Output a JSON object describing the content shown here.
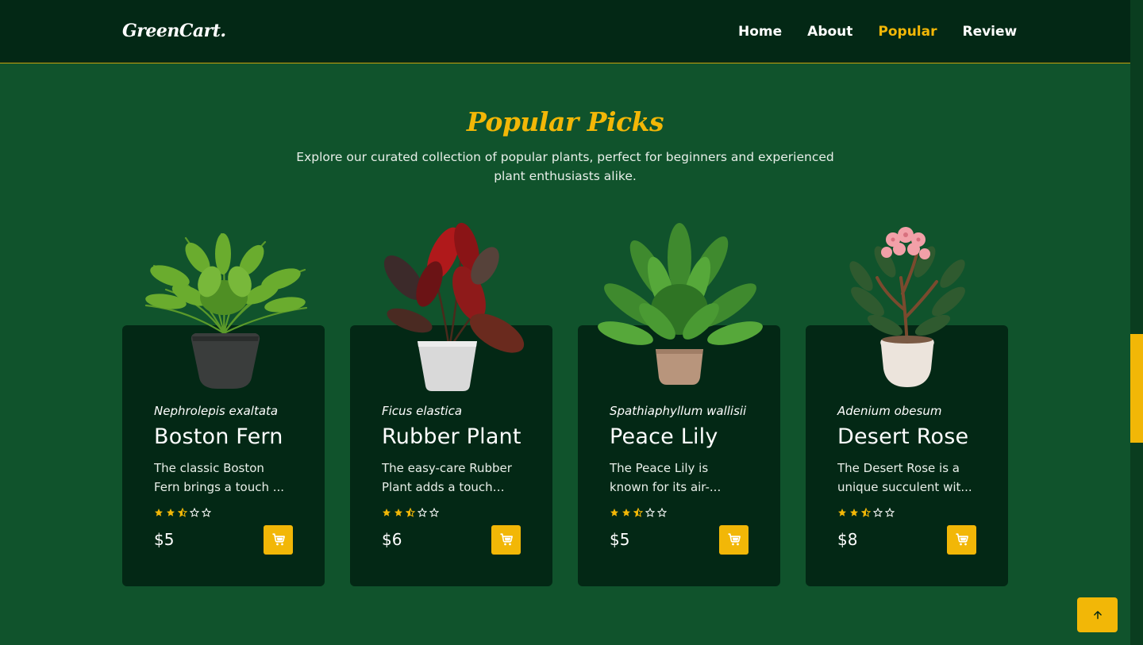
{
  "brand": {
    "logo": "GreenCart."
  },
  "nav": {
    "items": [
      {
        "label": "Home",
        "active": false
      },
      {
        "label": "About",
        "active": false
      },
      {
        "label": "Popular",
        "active": true
      },
      {
        "label": "Review",
        "active": false
      }
    ]
  },
  "section": {
    "title": "Popular Picks",
    "subtitle": "Explore our curated collection of popular plants, perfect for beginners and experienced plant enthusiasts alike."
  },
  "products": [
    {
      "scientific": "Nephrolepis exaltata",
      "name": "Boston Fern",
      "description": "The classic Boston Fern brings a touch ...",
      "rating": 2.5,
      "price": "$5",
      "image": "fern-plant"
    },
    {
      "scientific": "Ficus elastica",
      "name": "Rubber Plant",
      "description": "The easy-care Rubber Plant adds a touch of...",
      "rating": 2.5,
      "price": "$6",
      "image": "rubber-plant"
    },
    {
      "scientific": "Spathiaphyllum wallisii",
      "name": "Peace Lily",
      "description": "The Peace Lily is known for its air-...",
      "rating": 2.5,
      "price": "$5",
      "image": "peace-lily-plant"
    },
    {
      "scientific": "Adenium obesum",
      "name": "Desert Rose",
      "description": "The Desert Rose is a unique succulent wit...",
      "rating": 2.5,
      "price": "$8",
      "image": "desert-rose-plant"
    }
  ],
  "icons": {
    "cart": "cart-icon",
    "scroll_top": "arrow-up-icon",
    "star": "star-icon"
  },
  "colors": {
    "background": "#10532c",
    "navbar": "#032815",
    "card": "#032815",
    "accent": "#f2b707",
    "text": "#ffffff"
  }
}
